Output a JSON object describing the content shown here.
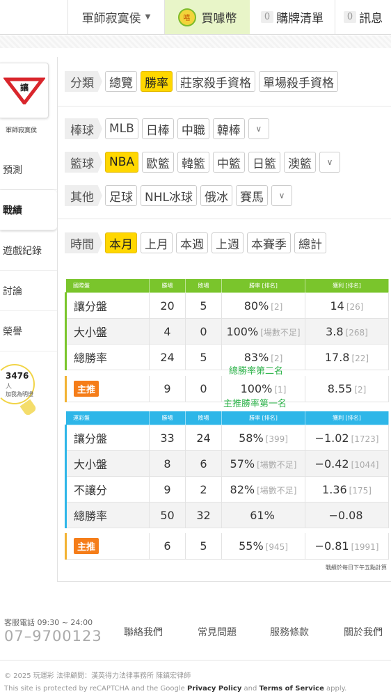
{
  "topbar": {
    "user_name": "軍師寂寞侯",
    "coin_icon_text": "嘻",
    "coin_label": "買噱幣",
    "cart_count": "0",
    "cart_label": "購牌清單",
    "msg_count": "0",
    "msg_label": "訊息"
  },
  "sidebar": {
    "logo_text": "讓",
    "logo_label": "軍師寂寞侯",
    "items": [
      {
        "label": "預測"
      },
      {
        "label": "戰績"
      },
      {
        "label": "遊戲紀錄"
      },
      {
        "label": "討論"
      },
      {
        "label": "榮譽"
      }
    ],
    "fans_count": "3476",
    "fans_unit": "人",
    "fans_sub": "加我為明燈"
  },
  "filters": {
    "category": {
      "label": "分類",
      "options": [
        "總覽",
        "勝率",
        "莊家殺手資格",
        "單場殺手資格"
      ],
      "selected": "勝率"
    },
    "baseball": {
      "label": "棒球",
      "options": [
        "MLB",
        "日棒",
        "中職",
        "韓棒"
      ]
    },
    "basketball": {
      "label": "籃球",
      "options": [
        "NBA",
        "歐籃",
        "韓籃",
        "中籃",
        "日籃",
        "澳籃"
      ],
      "selected": "NBA"
    },
    "other": {
      "label": "其他",
      "options": [
        "足球",
        "NHL冰球",
        "俄冰",
        "賽馬"
      ]
    },
    "time": {
      "label": "時間",
      "options": [
        "本月",
        "上月",
        "本週",
        "上週",
        "本賽季",
        "總計"
      ],
      "selected": "本月"
    }
  },
  "intl_table": {
    "headers": [
      "國際盤",
      "勝場",
      "敗場",
      "勝率 [排名]",
      "獲利 [排名]"
    ],
    "rows": [
      {
        "name": "讓分盤",
        "win": "20",
        "loss": "5",
        "rate": "80%",
        "rate_rank": "[2]",
        "profit": "14",
        "profit_rank": "[26]"
      },
      {
        "name": "大小盤",
        "win": "4",
        "loss": "0",
        "rate": "100%",
        "rate_rank": "[場數不足]",
        "profit": "3.8",
        "profit_rank": "[268]"
      },
      {
        "name": "總勝率",
        "win": "24",
        "loss": "5",
        "rate": "83%",
        "rate_rank": "[2]",
        "profit": "17.8",
        "profit_rank": "[22]"
      }
    ],
    "pick": {
      "label": "主推",
      "win": "9",
      "loss": "0",
      "rate": "100%",
      "rate_rank": "[1]",
      "profit": "8.55",
      "profit_rank": "[2]"
    },
    "annotation_total": "總勝率第二名",
    "annotation_pick": "主推勝率第一名"
  },
  "lottery_table": {
    "headers": [
      "運彩盤",
      "勝場",
      "敗場",
      "勝率 [排名]",
      "獲利 [排名]"
    ],
    "rows": [
      {
        "name": "讓分盤",
        "win": "33",
        "loss": "24",
        "rate": "58%",
        "rate_rank": "[399]",
        "profit": "−1.02",
        "profit_rank": "[1723]"
      },
      {
        "name": "大小盤",
        "win": "8",
        "loss": "6",
        "rate": "57%",
        "rate_rank": "[場數不足]",
        "profit": "−0.42",
        "profit_rank": "[1044]"
      },
      {
        "name": "不讓分",
        "win": "9",
        "loss": "2",
        "rate": "82%",
        "rate_rank": "[場數不足]",
        "profit": "1.36",
        "profit_rank": "[175]"
      },
      {
        "name": "總勝率",
        "win": "50",
        "loss": "32",
        "rate": "61%",
        "rate_rank": "",
        "profit": "−0.08",
        "profit_rank": ""
      }
    ],
    "pick": {
      "label": "主推",
      "win": "6",
      "loss": "5",
      "rate": "55%",
      "rate_rank": "[945]",
      "profit": "−0.81",
      "profit_rank": "[1991]"
    }
  },
  "footnote": "戰績於每日下午五點計算",
  "footer": {
    "service_label": "客服電話 09:30 ~ 24:00",
    "service_phone": "07–9700123",
    "links": [
      "聯絡我們",
      "常見問題",
      "服務條款",
      "關於我們"
    ],
    "copyright": "© 2025 玩運彩 法律顧問：漢英得力法律事務所 陳鎮宏律師",
    "recaptcha_pre": "This site is protected by reCAPTCHA and the Google ",
    "privacy": "Privacy Policy",
    "and": " and ",
    "terms": "Terms of Service",
    "apply": " apply."
  }
}
